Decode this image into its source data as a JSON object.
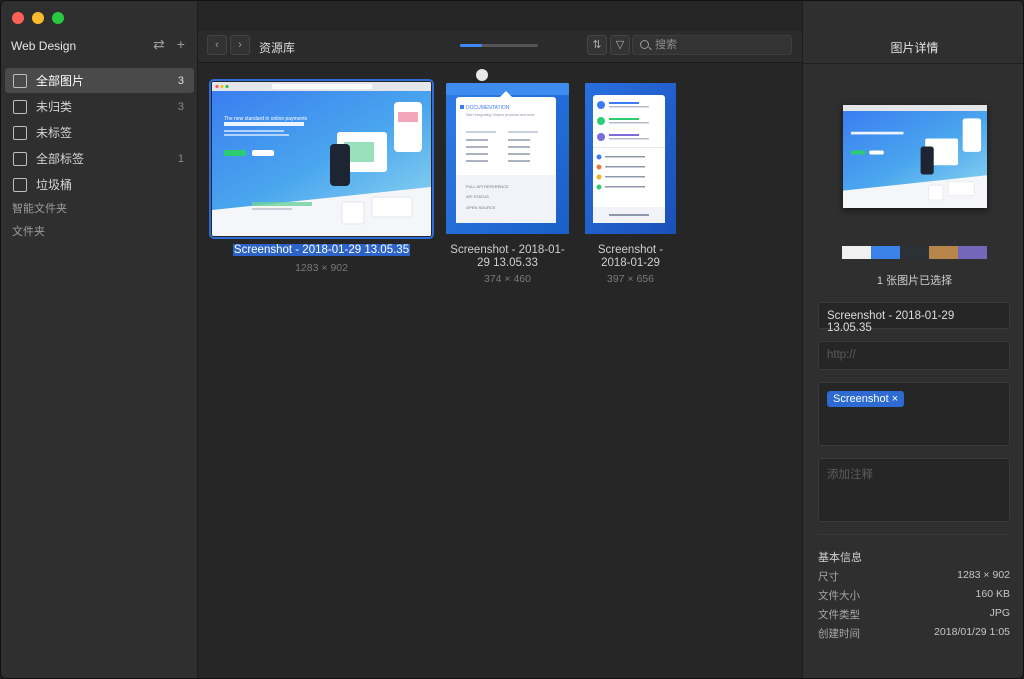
{
  "sidebar": {
    "library_title": "Web Design",
    "sync_icon": "swap-icon",
    "add_icon": "plus-icon",
    "items": [
      {
        "label": "全部图片",
        "count": "3",
        "icon": "all-images-icon"
      },
      {
        "label": "未归类",
        "count": "3",
        "icon": "uncategorized-icon"
      },
      {
        "label": "未标签",
        "count": "",
        "icon": "untagged-icon"
      },
      {
        "label": "全部标签",
        "count": "1",
        "icon": "tags-icon"
      },
      {
        "label": "垃圾桶",
        "count": "",
        "icon": "trash-icon"
      }
    ],
    "smart_folders_label": "智能文件夹",
    "folders_label": "文件夹"
  },
  "toolbar": {
    "back_icon": "chevron-left-icon",
    "forward_icon": "chevron-right-icon",
    "breadcrumb": "资源库",
    "zoom_level": 0.28,
    "sort_icon": "sort-icon",
    "filter_icon": "filter-icon",
    "search_placeholder": "搜索"
  },
  "items": [
    {
      "name": "Screenshot - 2018-01-29 13.05.35",
      "dims": "1283 × 902",
      "selected": true
    },
    {
      "name_line1": "Screenshot - 2018-01-",
      "name_line2": "29 13.05.33",
      "dims": "374 × 460",
      "selected": false
    },
    {
      "name_line1": "Screenshot -",
      "name_line2": "2018-01-29",
      "dims": "397 × 656",
      "selected": false
    }
  ],
  "panel": {
    "title": "图片详情",
    "palette": [
      "#f0f0f0",
      "#3b82e8",
      "#2b3135",
      "#b5854a",
      "#7466b8"
    ],
    "selection_count": "1 张图片已选择",
    "name_value": "Screenshot - 2018-01-29 13.05.35",
    "url_placeholder": "http://",
    "tag": "Screenshot ×",
    "note_placeholder": "添加注释",
    "info_title": "基本信息",
    "info": [
      {
        "label": "尺寸",
        "value": "1283 × 902"
      },
      {
        "label": "文件大小",
        "value": "160 KB"
      },
      {
        "label": "文件类型",
        "value": "JPG"
      },
      {
        "label": "创建时间",
        "value": "2018/01/29 1:05"
      }
    ]
  },
  "thumb_texts": {
    "headline": "The new standard in online payments",
    "doc_title": "DOCUMENTATION",
    "doc_sub": "Start integrating Stripe's products and tools",
    "api_ref": "FULL API REFERENCE",
    "api_status": "API STATUS",
    "open_source": "OPEN SOURCE"
  }
}
